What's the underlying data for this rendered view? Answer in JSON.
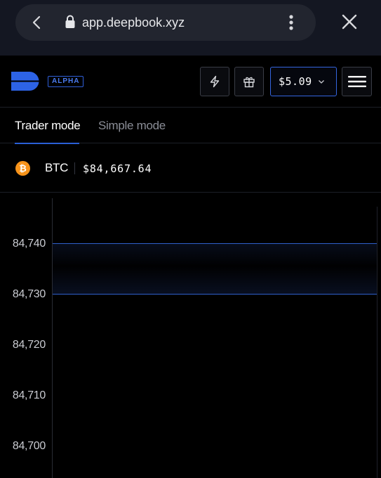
{
  "browser": {
    "url": "app.deepbook.xyz",
    "icons": [
      "back-chevron-icon",
      "lock-icon",
      "kebab-menu-icon",
      "close-icon"
    ]
  },
  "header": {
    "badge": "ALPHA",
    "balance": "$5.09",
    "icons": [
      "deepbook-logo",
      "lightning-bolt-icon",
      "gift-icon",
      "chevron-down-icon",
      "hamburger-menu-icon"
    ],
    "colors": {
      "accent": "#2f5fd8",
      "background": "#000000"
    }
  },
  "tabs": [
    {
      "label": "Trader mode",
      "active": true
    },
    {
      "label": "Simple mode",
      "active": false
    }
  ],
  "ticker": {
    "symbol": "BTC",
    "price": "$84,667.64",
    "icon": "bitcoin-icon",
    "icon_color": "#f7931a"
  },
  "chart": {
    "y_ticks": [
      "84,740",
      "84,730",
      "84,720",
      "84,710",
      "84,700"
    ],
    "band_color": "#2f5fc9"
  }
}
